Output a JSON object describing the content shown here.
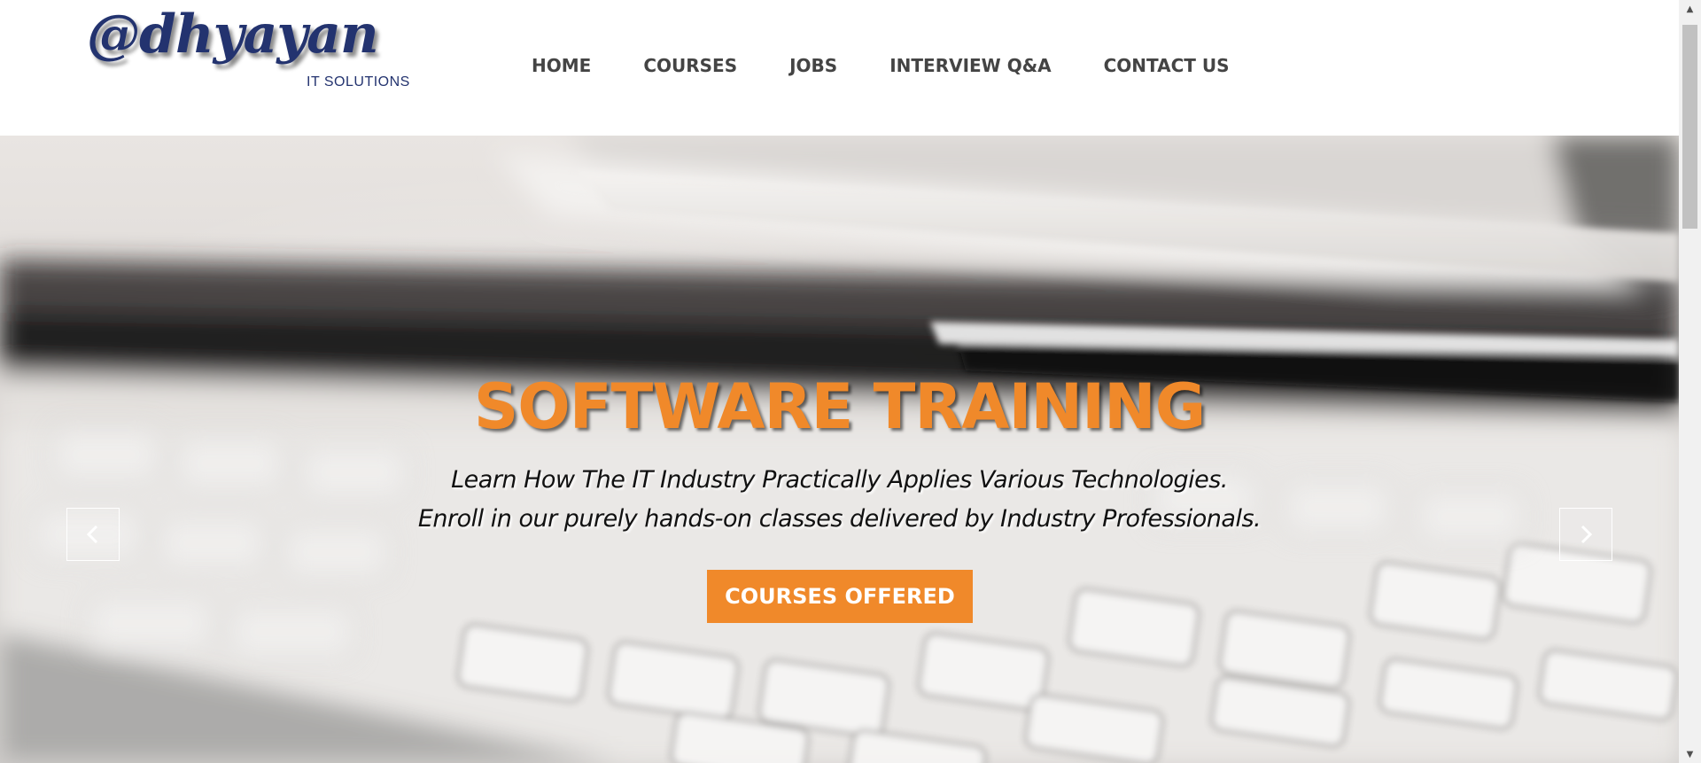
{
  "header": {
    "logo": {
      "script_text": "@dhyayan",
      "subtitle": "IT SOLUTIONS",
      "color": "#23336f"
    },
    "nav": [
      {
        "label": "HOME"
      },
      {
        "label": "COURSES"
      },
      {
        "label": "JOBS"
      },
      {
        "label": "INTERVIEW Q&A"
      },
      {
        "label": "CONTACT US"
      }
    ]
  },
  "hero": {
    "title": "SOFTWARE TRAINING",
    "subtitle_line1": "Learn How The IT Industry Practically Applies Various Technologies.",
    "subtitle_line2": "Enroll in our purely hands-on classes delivered by Industry Professionals.",
    "cta_label": "COURSES OFFERED",
    "prev_icon": "chevron-left-icon",
    "next_icon": "chevron-right-icon",
    "accent_color": "#f0892a",
    "background_image": "blurred-laptop-keyboard-photo"
  },
  "scrollbar": {
    "up_icon": "arrow-up-icon",
    "down_icon": "arrow-down-icon"
  }
}
